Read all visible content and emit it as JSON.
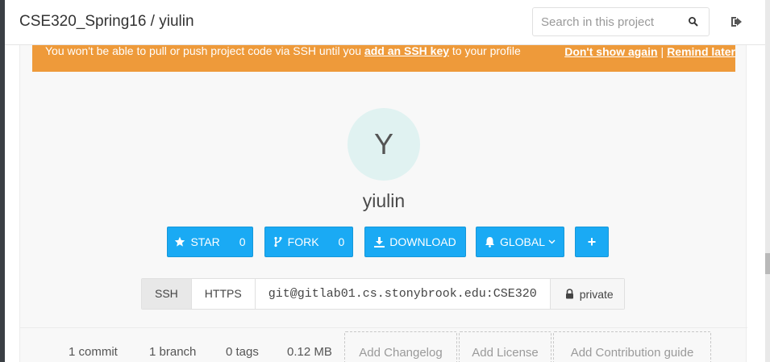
{
  "header": {
    "breadcrumb": "CSE320_Spring16 / yiulin",
    "search_placeholder": "Search in this project",
    "search_icon": "search-icon",
    "signout_icon": "sign-out-icon"
  },
  "alert": {
    "message_before": "You won't be able to pull or push project code via SSH until you",
    "link": "add an SSH key",
    "message_after": "to your profile",
    "dont_show": "Don't show again",
    "separator": "|",
    "remind_later": "Remind later"
  },
  "project": {
    "avatar_letter": "Y",
    "name": "yiulin"
  },
  "actions": {
    "star_label": "STAR",
    "star_count": "0",
    "fork_label": "FORK",
    "fork_count": "0",
    "download_label": "DOWNLOAD",
    "notify_label": "GLOBAL",
    "add_label": "+"
  },
  "clone": {
    "ssh_label": "SSH",
    "https_label": "HTTPS",
    "url": "git@gitlab01.cs.stonybrook.edu:CSE320",
    "visibility": "private"
  },
  "stats": {
    "commits": "1 commit",
    "branches": "1 branch",
    "tags": "0 tags",
    "size": "0.12 MB",
    "add_changelog": "Add Changelog",
    "add_license": "Add License",
    "add_contribution": "Add Contribution guide"
  },
  "colors": {
    "accent": "#1aaaf4",
    "alert": "#ee9a3a",
    "avatar_bg": "#e0f2f1"
  }
}
